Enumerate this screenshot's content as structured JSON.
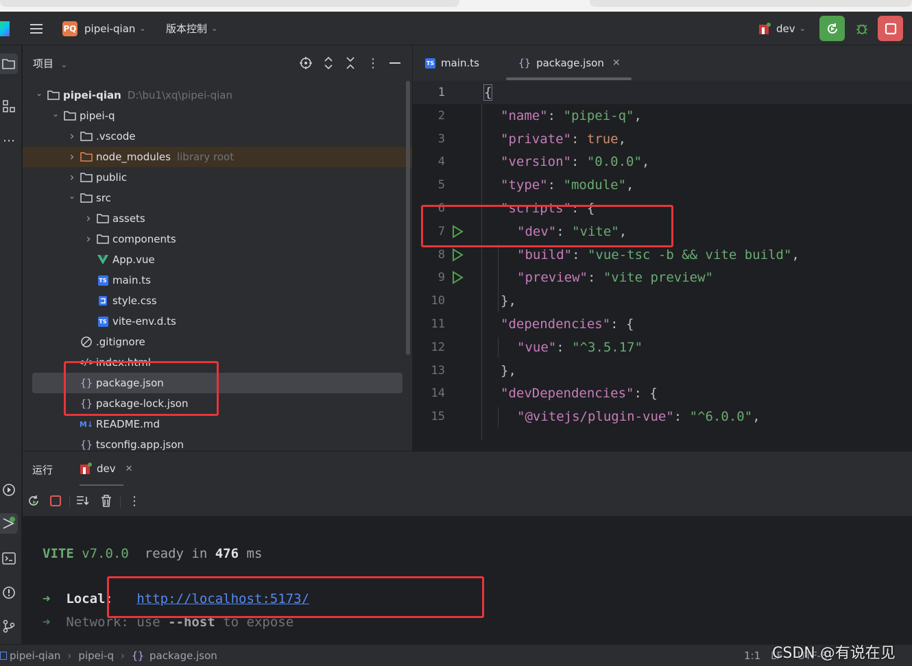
{
  "titlebar": {
    "project_badge": "PQ",
    "project_name": "pipei-qian",
    "vcs_menu": "版本控制",
    "run_config": "dev"
  },
  "project_panel": {
    "title": "项目",
    "tree": [
      {
        "label": "pipei-qian",
        "hint": "D:\\bu1\\xq\\pipei-qian"
      },
      {
        "label": "pipei-q"
      },
      {
        "label": ".vscode"
      },
      {
        "label": "node_modules",
        "hint": "library root"
      },
      {
        "label": "public"
      },
      {
        "label": "src"
      },
      {
        "label": "assets"
      },
      {
        "label": "components"
      },
      {
        "label": "App.vue"
      },
      {
        "label": "main.ts"
      },
      {
        "label": "style.css"
      },
      {
        "label": "vite-env.d.ts"
      },
      {
        "label": ".gitignore"
      },
      {
        "label": "index.html"
      },
      {
        "label": "package.json"
      },
      {
        "label": "package-lock.json"
      },
      {
        "label": "README.md"
      },
      {
        "label": "tsconfig.app.json"
      }
    ]
  },
  "editor": {
    "tabs": [
      {
        "label": "main.ts"
      },
      {
        "label": "package.json"
      }
    ],
    "lines": [
      {
        "num": "1"
      },
      {
        "num": "2",
        "key": "\"name\"",
        "val": "\"pipei-q\""
      },
      {
        "num": "3",
        "key": "\"private\"",
        "val": "true"
      },
      {
        "num": "4",
        "key": "\"version\"",
        "val": "\"0.0.0\""
      },
      {
        "num": "5",
        "key": "\"type\"",
        "val": "\"module\""
      },
      {
        "num": "6",
        "key": "\"scripts\""
      },
      {
        "num": "7",
        "key": "\"dev\"",
        "val": "\"vite\""
      },
      {
        "num": "8",
        "key": "\"build\"",
        "val": "\"vue-tsc -b && vite build\""
      },
      {
        "num": "9",
        "key": "\"preview\"",
        "val": "\"vite preview\""
      },
      {
        "num": "10"
      },
      {
        "num": "11",
        "key": "\"dependencies\""
      },
      {
        "num": "12",
        "key": "\"vue\"",
        "val": "\"^3.5.17\""
      },
      {
        "num": "13"
      },
      {
        "num": "14",
        "key": "\"devDependencies\""
      },
      {
        "num": "15",
        "key": "\"@vitejs/plugin-vue\"",
        "val": "\"^6.0.0\""
      }
    ]
  },
  "run_panel": {
    "title": "运行",
    "tab": "dev",
    "console": {
      "vite": "VITE",
      "version": "v7.0.0",
      "ready": "ready in",
      "ms_value": "476",
      "ms_unit": "ms",
      "arrow": "➜",
      "local_label": "Local",
      "local_url": "http://localhost:5173/",
      "network_label": "Network",
      "network_use": "use",
      "network_flag": "--host",
      "network_tail": "to expose"
    }
  },
  "statusbar": {
    "crumbs": [
      "pipei-qian",
      "pipei-q",
      "package.json"
    ],
    "position": "1:1",
    "line_sep": "LF",
    "encoding": "UTF-8",
    "watermark": "CSDN @有说在见"
  },
  "colors": {
    "accent_red": "#e8353a",
    "run_green": "#4fa14f",
    "link_blue": "#548af7"
  }
}
